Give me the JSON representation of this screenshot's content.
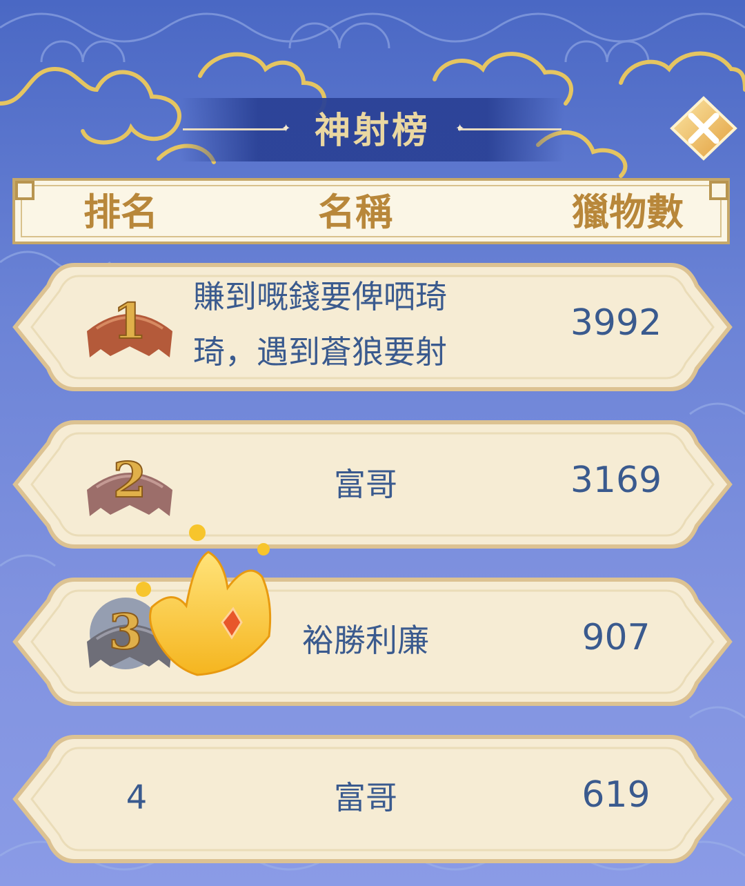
{
  "title": "神射榜",
  "header": {
    "rank": "排名",
    "name": "名稱",
    "score": "獵物數"
  },
  "rows": [
    {
      "rank": "1",
      "name_line1": "賺到嘅錢要俾哂琦",
      "name_line2": "琦，遇到蒼狼要射",
      "score": "3992",
      "medal": "gold-medal-icon"
    },
    {
      "rank": "2",
      "name": "富哥",
      "score": "3169",
      "medal": "silver-medal-icon"
    },
    {
      "rank": "3",
      "name": "裕勝利廉",
      "score": "907",
      "medal": "bronze-medal-icon"
    },
    {
      "rank": "4",
      "name": "富哥",
      "score": "619"
    }
  ],
  "icons": {
    "close": "close-icon",
    "crown": "crown-icon"
  },
  "colors": {
    "background": "#6b83d6",
    "title_band": "#2b4296",
    "title_text": "#ead7a1",
    "header_text": "#b8873a",
    "row_text": "#3a5a8e",
    "plate": "#f6ecd4",
    "plate_border": "#dcc292"
  }
}
